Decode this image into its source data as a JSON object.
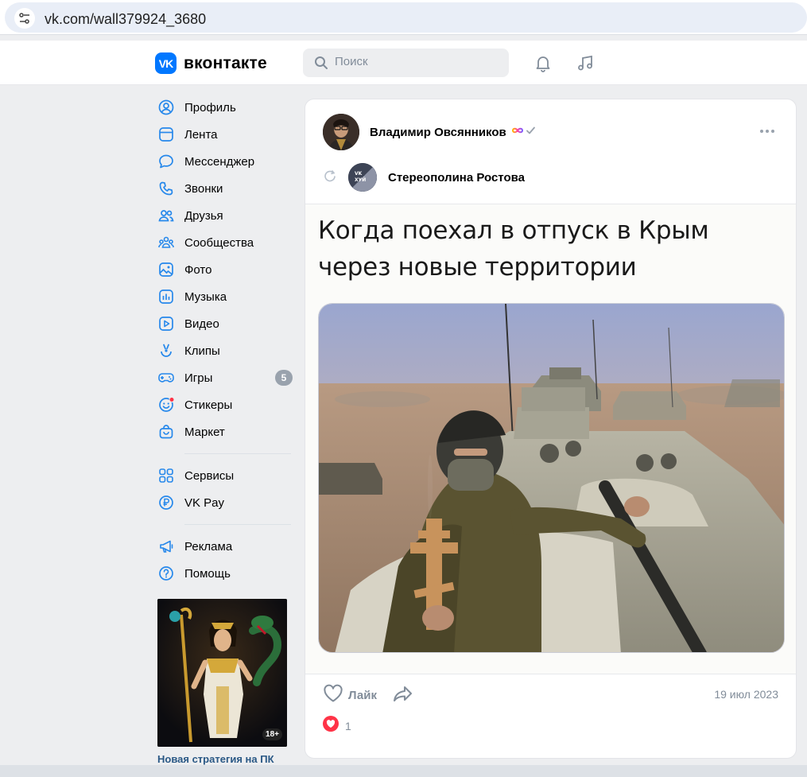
{
  "browser": {
    "url": "vk.com/wall379924_3680"
  },
  "header": {
    "logo_text": "вконтакте",
    "logo_mark": "VK",
    "search_placeholder": "Поиск"
  },
  "sidebar": {
    "items": [
      {
        "label": "Профиль",
        "icon": "profile-icon"
      },
      {
        "label": "Лента",
        "icon": "feed-icon"
      },
      {
        "label": "Мессенджер",
        "icon": "messenger-icon"
      },
      {
        "label": "Звонки",
        "icon": "phone-icon"
      },
      {
        "label": "Друзья",
        "icon": "friends-icon"
      },
      {
        "label": "Сообщества",
        "icon": "communities-icon"
      },
      {
        "label": "Фото",
        "icon": "photo-icon"
      },
      {
        "label": "Музыка",
        "icon": "music-icon"
      },
      {
        "label": "Видео",
        "icon": "video-icon"
      },
      {
        "label": "Клипы",
        "icon": "clips-icon"
      },
      {
        "label": "Игры",
        "icon": "games-icon",
        "badge": "5"
      },
      {
        "label": "Стикеры",
        "icon": "stickers-icon"
      },
      {
        "label": "Маркет",
        "icon": "market-icon"
      }
    ],
    "secondary": [
      {
        "label": "Сервисы",
        "icon": "services-icon"
      },
      {
        "label": "VK Pay",
        "icon": "vkpay-icon"
      }
    ],
    "tertiary": [
      {
        "label": "Реклама",
        "icon": "megaphone-icon"
      },
      {
        "label": "Помощь",
        "icon": "help-icon"
      }
    ],
    "ad": {
      "caption": "Новая стратегия на ПК",
      "age": "18+"
    }
  },
  "post": {
    "author": "Владимир Овсянников",
    "repost_author": "Стереополина Ростова",
    "repost_avatar_text": "VK\nХУЙ",
    "title": "Когда поехал в отпуск в Крым через новые территории",
    "like_label": "Лайк",
    "date": "19 июл 2023",
    "reactions_count": "1"
  },
  "colors": {
    "accent": "#0077ff",
    "muted": "#818c99",
    "like_red": "#ff3347"
  }
}
